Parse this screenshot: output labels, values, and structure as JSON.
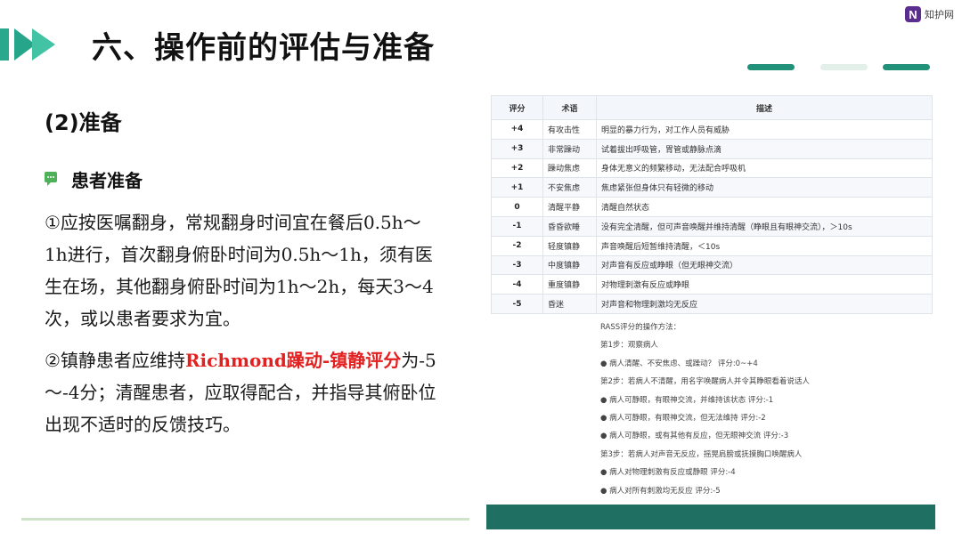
{
  "header": {
    "title": "六、操作前的评估与准备",
    "logo_mark": "N",
    "logo_text": "知护网",
    "colors": {
      "accent": "#27a58a",
      "accent_light": "#42c4a4",
      "pill": "#22917a",
      "bottom_bar": "#1f6f62",
      "highlight": "#e32020"
    }
  },
  "left": {
    "subtitle": "(2)准备",
    "bullet_icon": "chat-bubble-icon",
    "section_heading": "患者准备",
    "para1": {
      "t1": "①应按医嘱翻身，常规翻身时间宜在餐后",
      "t2": "0.5h～1h",
      "t3": "进行，首次翻身俯卧时间为",
      "t4": "0.5h～1h",
      "t5": "，须有医生在场，其他翻身俯卧时间为",
      "t6": "1h～2h",
      "t7": "，每天",
      "t8": "3～4",
      "t9": "次，或以患者要求为宜。"
    },
    "para2": {
      "t1": "②镇静患者应维持",
      "t2": "Richmond",
      "t3": "躁动",
      "t4": "-",
      "t5": "镇静评分",
      "t6": "为",
      "t7": "-5～-4",
      "t8": "分；清醒患者，应取得配合，并指导其俯卧位出现不适时的反馈技巧。"
    }
  },
  "table": {
    "headers": [
      "评分",
      "术语",
      "描述"
    ],
    "rows": [
      {
        "score": "+4",
        "term": "有攻击性",
        "desc": "明显的暴力行为，对工作人员有威胁"
      },
      {
        "score": "+3",
        "term": "非常躁动",
        "desc": "试着拔出呼吸管，胃管或静脉点滴"
      },
      {
        "score": "+2",
        "term": "躁动焦虑",
        "desc": "身体无意义的频繁移动，无法配合呼吸机"
      },
      {
        "score": "+1",
        "term": "不安焦虑",
        "desc": "焦虑紧张但身体只有轻微的移动"
      },
      {
        "score": "0",
        "term": "清醒平静",
        "desc": "清醒自然状态"
      },
      {
        "score": "-1",
        "term": "昏昏欲睡",
        "desc": "没有完全清醒，但可声音唤醒并维持清醒（睁眼且有眼神交流），＞10s"
      },
      {
        "score": "-2",
        "term": "轻度镇静",
        "desc": "声音唤醒后短暂维持清醒，＜10s"
      },
      {
        "score": "-3",
        "term": "中度镇静",
        "desc": "对声音有反应或睁眼（但无眼神交流）"
      },
      {
        "score": "-4",
        "term": "重度镇静",
        "desc": "对物理刺激有反应或睁眼"
      },
      {
        "score": "-5",
        "term": "昏迷",
        "desc": "对声音和物理刺激均无反应"
      }
    ]
  },
  "method": {
    "lines": [
      "RASS评分的操作方法：",
      "第1步：观察病人",
      "● 病人清醒、不安焦虑、或躁动？ 评分:0~+4",
      "第2步：若病人不清醒，用名字唤醒病人并令其睁眼看着说话人",
      "● 病人可静眼，有眼神交流，并维持该状态 评分:-1",
      "● 病人可静眼，有眼神交流，但无法维持 评分:-2",
      "● 病人可静眼，或有其他有反应，但无眼神交流 评分:-3",
      "第3步：若病人对声音无反应，摇晃肩膀或抚摸胸口唤醒病人",
      "● 病人对物理刺激有反应或静眼 评分:-4",
      "● 病人对所有刺激均无反应 评分:-5"
    ]
  }
}
